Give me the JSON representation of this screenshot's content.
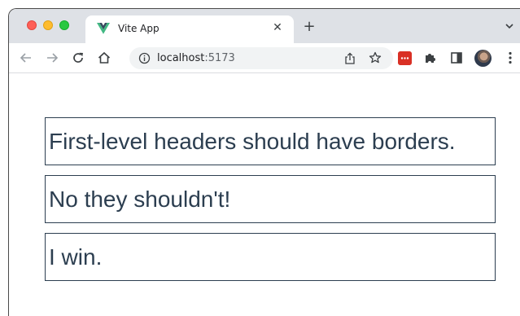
{
  "browser": {
    "tab": {
      "title": "Vite App",
      "close_glyph": "✕",
      "favicon": "vue-logo-icon"
    },
    "new_tab_glyph": "+",
    "address": {
      "host": "localhost",
      "port": ":5173"
    }
  },
  "page": {
    "headers": [
      "First-level headers should have borders.",
      "No they shouldn't!",
      "I win."
    ]
  },
  "colors": {
    "text": "#2c3e50",
    "border": "#2c3e50",
    "tabstrip": "#dee1e6"
  }
}
